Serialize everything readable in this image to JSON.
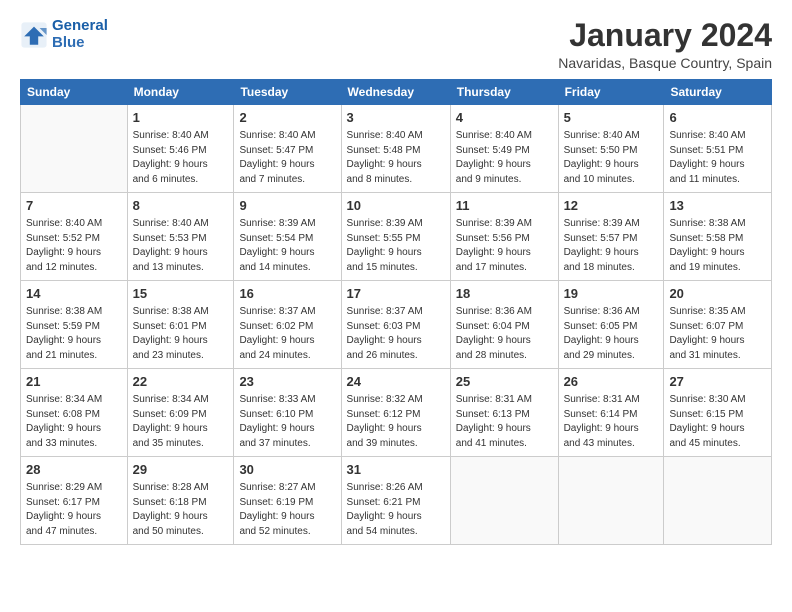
{
  "header": {
    "logo_line1": "General",
    "logo_line2": "Blue",
    "month": "January 2024",
    "location": "Navaridas, Basque Country, Spain"
  },
  "weekdays": [
    "Sunday",
    "Monday",
    "Tuesday",
    "Wednesday",
    "Thursday",
    "Friday",
    "Saturday"
  ],
  "weeks": [
    [
      {
        "day": "",
        "info": ""
      },
      {
        "day": "1",
        "info": "Sunrise: 8:40 AM\nSunset: 5:46 PM\nDaylight: 9 hours\nand 6 minutes."
      },
      {
        "day": "2",
        "info": "Sunrise: 8:40 AM\nSunset: 5:47 PM\nDaylight: 9 hours\nand 7 minutes."
      },
      {
        "day": "3",
        "info": "Sunrise: 8:40 AM\nSunset: 5:48 PM\nDaylight: 9 hours\nand 8 minutes."
      },
      {
        "day": "4",
        "info": "Sunrise: 8:40 AM\nSunset: 5:49 PM\nDaylight: 9 hours\nand 9 minutes."
      },
      {
        "day": "5",
        "info": "Sunrise: 8:40 AM\nSunset: 5:50 PM\nDaylight: 9 hours\nand 10 minutes."
      },
      {
        "day": "6",
        "info": "Sunrise: 8:40 AM\nSunset: 5:51 PM\nDaylight: 9 hours\nand 11 minutes."
      }
    ],
    [
      {
        "day": "7",
        "info": "Sunrise: 8:40 AM\nSunset: 5:52 PM\nDaylight: 9 hours\nand 12 minutes."
      },
      {
        "day": "8",
        "info": "Sunrise: 8:40 AM\nSunset: 5:53 PM\nDaylight: 9 hours\nand 13 minutes."
      },
      {
        "day": "9",
        "info": "Sunrise: 8:39 AM\nSunset: 5:54 PM\nDaylight: 9 hours\nand 14 minutes."
      },
      {
        "day": "10",
        "info": "Sunrise: 8:39 AM\nSunset: 5:55 PM\nDaylight: 9 hours\nand 15 minutes."
      },
      {
        "day": "11",
        "info": "Sunrise: 8:39 AM\nSunset: 5:56 PM\nDaylight: 9 hours\nand 17 minutes."
      },
      {
        "day": "12",
        "info": "Sunrise: 8:39 AM\nSunset: 5:57 PM\nDaylight: 9 hours\nand 18 minutes."
      },
      {
        "day": "13",
        "info": "Sunrise: 8:38 AM\nSunset: 5:58 PM\nDaylight: 9 hours\nand 19 minutes."
      }
    ],
    [
      {
        "day": "14",
        "info": "Sunrise: 8:38 AM\nSunset: 5:59 PM\nDaylight: 9 hours\nand 21 minutes."
      },
      {
        "day": "15",
        "info": "Sunrise: 8:38 AM\nSunset: 6:01 PM\nDaylight: 9 hours\nand 23 minutes."
      },
      {
        "day": "16",
        "info": "Sunrise: 8:37 AM\nSunset: 6:02 PM\nDaylight: 9 hours\nand 24 minutes."
      },
      {
        "day": "17",
        "info": "Sunrise: 8:37 AM\nSunset: 6:03 PM\nDaylight: 9 hours\nand 26 minutes."
      },
      {
        "day": "18",
        "info": "Sunrise: 8:36 AM\nSunset: 6:04 PM\nDaylight: 9 hours\nand 28 minutes."
      },
      {
        "day": "19",
        "info": "Sunrise: 8:36 AM\nSunset: 6:05 PM\nDaylight: 9 hours\nand 29 minutes."
      },
      {
        "day": "20",
        "info": "Sunrise: 8:35 AM\nSunset: 6:07 PM\nDaylight: 9 hours\nand 31 minutes."
      }
    ],
    [
      {
        "day": "21",
        "info": "Sunrise: 8:34 AM\nSunset: 6:08 PM\nDaylight: 9 hours\nand 33 minutes."
      },
      {
        "day": "22",
        "info": "Sunrise: 8:34 AM\nSunset: 6:09 PM\nDaylight: 9 hours\nand 35 minutes."
      },
      {
        "day": "23",
        "info": "Sunrise: 8:33 AM\nSunset: 6:10 PM\nDaylight: 9 hours\nand 37 minutes."
      },
      {
        "day": "24",
        "info": "Sunrise: 8:32 AM\nSunset: 6:12 PM\nDaylight: 9 hours\nand 39 minutes."
      },
      {
        "day": "25",
        "info": "Sunrise: 8:31 AM\nSunset: 6:13 PM\nDaylight: 9 hours\nand 41 minutes."
      },
      {
        "day": "26",
        "info": "Sunrise: 8:31 AM\nSunset: 6:14 PM\nDaylight: 9 hours\nand 43 minutes."
      },
      {
        "day": "27",
        "info": "Sunrise: 8:30 AM\nSunset: 6:15 PM\nDaylight: 9 hours\nand 45 minutes."
      }
    ],
    [
      {
        "day": "28",
        "info": "Sunrise: 8:29 AM\nSunset: 6:17 PM\nDaylight: 9 hours\nand 47 minutes."
      },
      {
        "day": "29",
        "info": "Sunrise: 8:28 AM\nSunset: 6:18 PM\nDaylight: 9 hours\nand 50 minutes."
      },
      {
        "day": "30",
        "info": "Sunrise: 8:27 AM\nSunset: 6:19 PM\nDaylight: 9 hours\nand 52 minutes."
      },
      {
        "day": "31",
        "info": "Sunrise: 8:26 AM\nSunset: 6:21 PM\nDaylight: 9 hours\nand 54 minutes."
      },
      {
        "day": "",
        "info": ""
      },
      {
        "day": "",
        "info": ""
      },
      {
        "day": "",
        "info": ""
      }
    ]
  ]
}
